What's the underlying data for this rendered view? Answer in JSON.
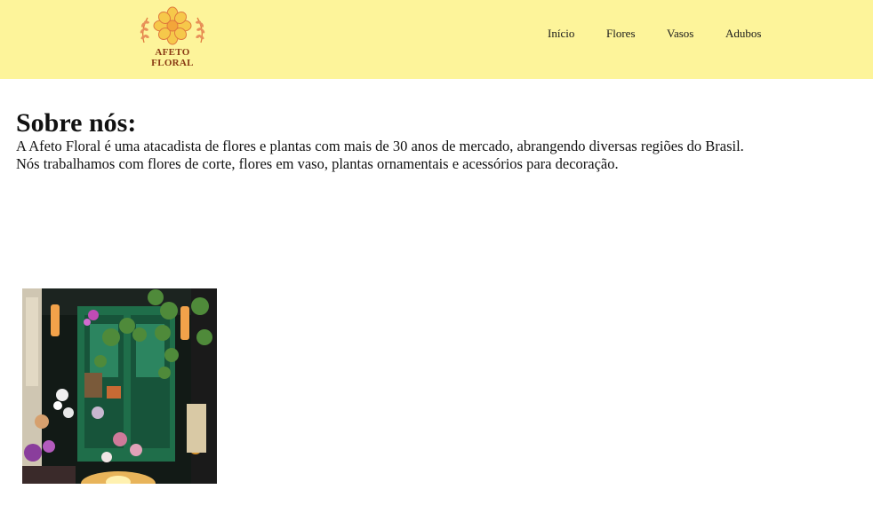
{
  "header": {
    "logo_text": "AFETO FLORAL",
    "background_color": "#fdf49a",
    "logo_color": "#e07a3c",
    "nav": [
      "Início",
      "Flores",
      "Vasos",
      "Adubos"
    ]
  },
  "about": {
    "title": "Sobre nós:",
    "line1": "A Afeto Floral é uma atacadista de flores e plantas com mais de 30 anos de mercado, abrangendo diversas regiões do Brasil.",
    "line2": "Nós trabalhamos com flores de corte, flores em vaso, plantas ornamentais e acessórios para decoração."
  },
  "photo": {
    "subject": "flower-shop-storefront"
  }
}
